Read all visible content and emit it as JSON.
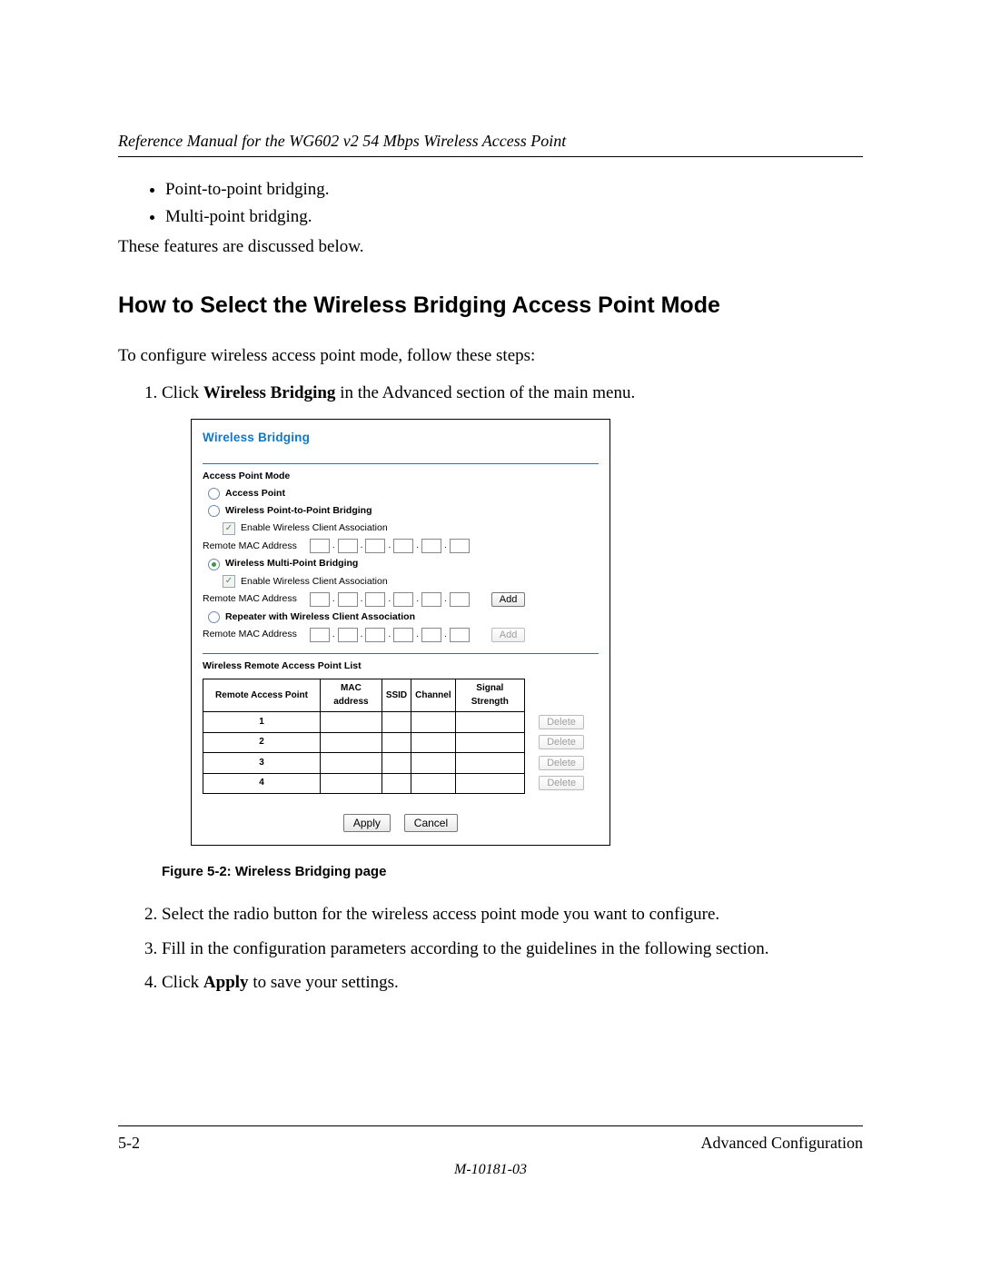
{
  "header": "Reference Manual for the WG602 v2 54 Mbps Wireless Access Point",
  "intro": {
    "bullets": [
      "Point-to-point bridging.",
      "Multi-point bridging."
    ],
    "after": "These features are discussed below."
  },
  "heading": "How to Select the Wireless Bridging Access Point Mode",
  "lead": "To configure wireless access point mode, follow these steps:",
  "step1_a": "Click ",
  "step1_b": "Wireless Bridging",
  "step1_c": " in the Advanced section of the main menu.",
  "shot": {
    "title": "Wireless Bridging",
    "ap_mode_head": "Access Point Mode",
    "opt_ap": "Access Point",
    "opt_p2p": "Wireless Point-to-Point Bridging",
    "chk_assoc": "Enable Wireless Client Association",
    "remote_mac_label": "Remote MAC Address",
    "opt_mp": "Wireless Multi-Point Bridging",
    "opt_rep": "Repeater with Wireless Client Association",
    "add": "Add",
    "list_head": "Wireless Remote Access Point List",
    "cols": {
      "rap": "Remote Access Point",
      "mac": "MAC address",
      "ssid": "SSID",
      "ch": "Channel",
      "sig": "Signal Strength"
    },
    "rows": [
      "1",
      "2",
      "3",
      "4"
    ],
    "delete": "Delete",
    "apply": "Apply",
    "cancel": "Cancel"
  },
  "caption": "Figure 5-2: Wireless Bridging page",
  "step2": "Select the radio button for the wireless access point mode you want to configure.",
  "step3": "Fill in the configuration parameters according to the guidelines in the following section.",
  "step4_a": "Click ",
  "step4_b": "Apply",
  "step4_c": " to save your settings.",
  "footer": {
    "left": "5-2",
    "right": "Advanced Configuration",
    "doc": "M-10181-03"
  }
}
